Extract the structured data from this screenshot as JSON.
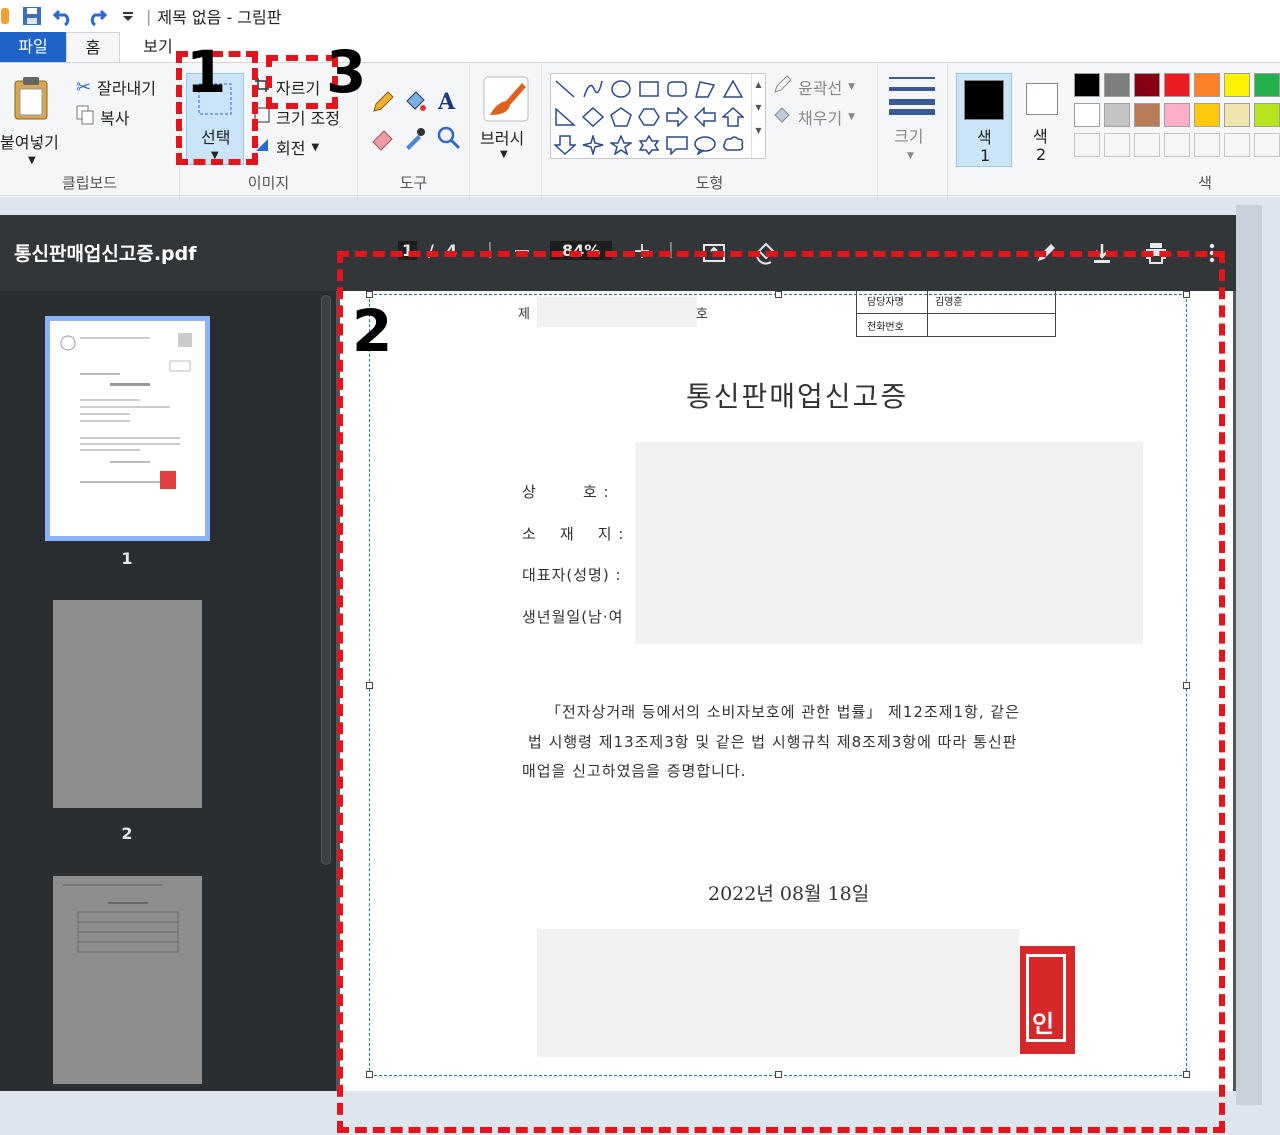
{
  "window": {
    "title": "제목 없음 - 그림판",
    "quick_access_icons": [
      "paint-app-icon",
      "save-icon",
      "undo-icon",
      "redo-icon",
      "customize-dropdown-icon"
    ]
  },
  "ribbon_tabs": {
    "file": "파일",
    "home": "홈",
    "view": "보기"
  },
  "ribbon": {
    "clipboard": {
      "paste": "붙여넣기",
      "cut": "잘라내기",
      "copy": "복사",
      "label": "클립보드"
    },
    "image": {
      "select": "선택",
      "crop": "자르기",
      "resize": "크기 조정",
      "rotate": "회전",
      "label": "이미지"
    },
    "tools": {
      "label": "도구"
    },
    "brushes": {
      "label": "브러시"
    },
    "shapes": {
      "outline": "윤곽선",
      "fill": "채우기",
      "label": "도형"
    },
    "size": {
      "label": "크기"
    },
    "color1": {
      "label_top": "색",
      "label_bottom": "1"
    },
    "color2": {
      "label_top": "색",
      "label_bottom": "2"
    },
    "colors": {
      "label": "색",
      "row1": [
        "#000000",
        "#7f7f7f",
        "#880015",
        "#ed1c24",
        "#ff7f27",
        "#fff200",
        "#22b14c"
      ],
      "row2": [
        "#ffffff",
        "#c3c3c3",
        "#b97a57",
        "#ffaec9",
        "#ffc90e",
        "#efe4b0",
        "#b5e61d"
      ]
    }
  },
  "pdf_viewer": {
    "file_name": "통신판매업신고증.pdf",
    "page_current": "1",
    "page_separator": "/",
    "page_total": "4",
    "zoom": "84%",
    "thumbnail_numbers": [
      "1",
      "2"
    ]
  },
  "document": {
    "no_prefix": "제",
    "no_suffix": "호",
    "header_table": {
      "row1_label": "담당자명",
      "row1_value": "김영훈",
      "row2_label": "전화번호"
    },
    "title": "통신판매업신고증",
    "fields": [
      "상        호 :",
      "소    재    지 :",
      "대표자(성명) :",
      "생년월일(남·여"
    ],
    "body_line1": "「전자상거래 등에서의 소비자보호에 관한 법률」 제12조제1항, 같은",
    "body_line2": "법 시행령 제13조제3항 및 같은 법 시행규칙 제8조제3항에 따라 통신판",
    "body_line3": "매업을 신고하였음을 증명합니다.",
    "date": "2022년  08월  18일",
    "seal_text": "인"
  },
  "annotations": {
    "n1": "1",
    "n2": "2",
    "n3": "3"
  }
}
